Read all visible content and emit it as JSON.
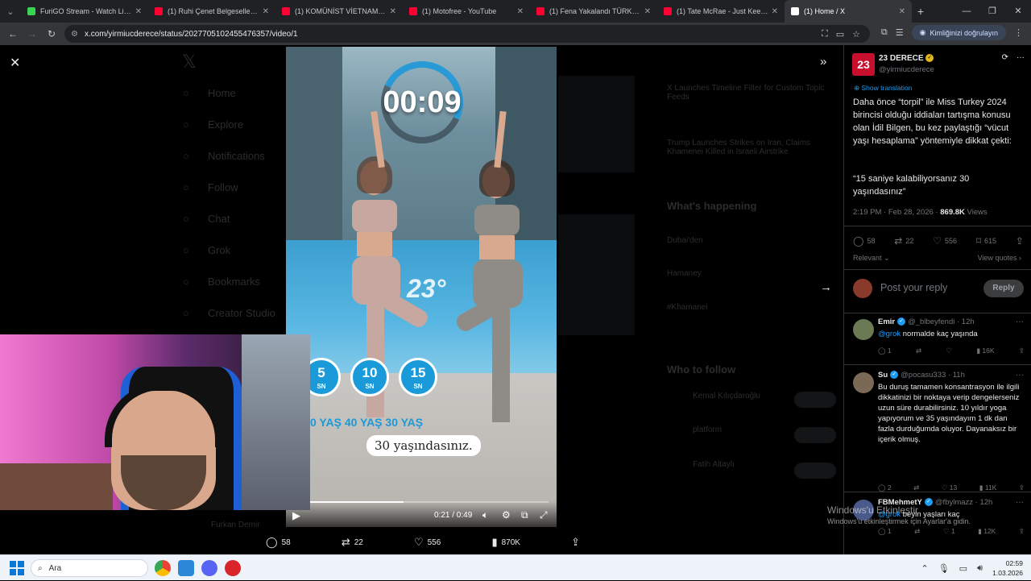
{
  "browser": {
    "tabs": [
      {
        "title": "FuriGO Stream - Watch Live on",
        "color": "#39d353",
        "active": false
      },
      {
        "title": "(1) Ruhi Çenet Belgeselleri - Yo",
        "color": "#ff0033",
        "active": false
      },
      {
        "title": "(1) KOMÜNİST VİETNAM'A GE",
        "color": "#ff0033",
        "active": false
      },
      {
        "title": "(1) Motofree - YouTube",
        "color": "#ff0033",
        "active": false
      },
      {
        "title": "(1) Fena Yakalandı TÜRKİYE'DE",
        "color": "#ff0033",
        "active": false
      },
      {
        "title": "(1) Tate McRae - Just Keep Wat",
        "color": "#ff0033",
        "active": false
      },
      {
        "title": "(1) Home / X",
        "color": "#ffffff",
        "active": true
      }
    ],
    "url": "x.com/yirmiucderece/status/2027705102455476357/video/1",
    "identity_button": "Kimliğinizi doğrulayın"
  },
  "video": {
    "timer": "00:09",
    "brand_mark": "23°",
    "seconds": [
      {
        "n": "5",
        "unit": "SN"
      },
      {
        "n": "10",
        "unit": "SN"
      },
      {
        "n": "15",
        "unit": "SN"
      }
    ],
    "age_row": "0 YAŞ  40 YAŞ  30 YAŞ",
    "result": "30 yaşındasınız.",
    "time": "0:21 / 0:49",
    "progress_fraction": 0.43
  },
  "action_bar": {
    "replies": "58",
    "reposts": "22",
    "likes": "556",
    "views": "870K"
  },
  "tweet": {
    "author_name": "23 DERECE",
    "author_handle": "@yirmiucderece",
    "avatar_text": "23",
    "show_translation": "Show translation",
    "text": "Daha önce “torpil” ile Miss Turkey 2024 birincisi olduğu iddiaları tartışma konusu olan İdil Bilgen, bu kez paylaştığı “vücut yaşı hesaplama” yöntemiyle dikkat çekti:",
    "quote": "“15 saniye kalabiliyorsanız 30 yaşındasınız”",
    "time": "2:19 PM · Feb 28, 2026 · ",
    "views_count": "869.8K",
    "views_label": " Views",
    "stats": {
      "replies": "58",
      "reposts": "22",
      "likes": "556",
      "bookmarks": "615"
    },
    "relevant": "Relevant",
    "view_quotes": "View quotes"
  },
  "reply_box": {
    "placeholder": "Post your reply",
    "button": "Reply"
  },
  "replies": [
    {
      "name": "Emir",
      "handle": "@_blbeyfendi · 12h",
      "mention": "@grok",
      "text": " normalde kaç yaşında",
      "stats": {
        "replies": "1",
        "reposts": "",
        "likes": "",
        "views": "16K"
      }
    },
    {
      "name": "Su",
      "handle": "@pocasu333 · 11h",
      "mention": "",
      "text": "Bu duruş tamamen konsantrasyon ile ilgili dikkatinizi bir noktaya verip dengelerseniz uzun süre durabilirsiniz. 10 yıldır yoga yapıyorum ve 35 yaşındayım 1 dk dan fazla durduğumda oluyor. Dayanaksız bir içerik olmuş.",
      "stats": {
        "replies": "2",
        "reposts": "",
        "likes": "13",
        "views": "11K"
      }
    },
    {
      "name": "FBMehmetY",
      "handle": "@fbylmazz · 12h",
      "mention": "@grok",
      "text": " beyin yaşları kaç",
      "stats": {
        "replies": "1",
        "reposts": "",
        "likes": "1",
        "views": "12K"
      }
    }
  ],
  "watermark": {
    "line1": "Windows'u Etkinleştir",
    "line2": "Windows'u etkinleştirmek için Ayarlar'a gidin."
  },
  "taskbar": {
    "search_label": "Ara",
    "time": "02:59",
    "date": "1.03.2026"
  },
  "background_nav": [
    "Home",
    "Explore",
    "Notifications",
    "Follow",
    "Chat",
    "Grok",
    "Bookmarks",
    "Creator Studio"
  ]
}
